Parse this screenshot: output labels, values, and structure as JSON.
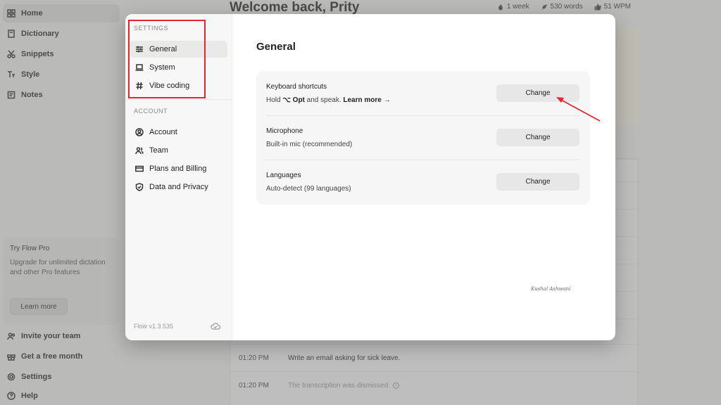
{
  "sidebar": {
    "items": [
      {
        "label": "Home",
        "icon": "grid-icon"
      },
      {
        "label": "Dictionary",
        "icon": "book-icon"
      },
      {
        "label": "Snippets",
        "icon": "scissors-icon"
      },
      {
        "label": "Style",
        "icon": "text-style-icon"
      },
      {
        "label": "Notes",
        "icon": "note-icon"
      }
    ],
    "promo": {
      "title": "Try Flow Pro",
      "description": "Upgrade for unlimited dictation and other Pro features",
      "button": "Learn more"
    },
    "bottom_items": [
      {
        "label": "Invite your team",
        "icon": "users-icon"
      },
      {
        "label": "Get a free month",
        "icon": "gift-icon"
      },
      {
        "label": "Settings",
        "icon": "gear-icon"
      },
      {
        "label": "Help",
        "icon": "help-icon"
      }
    ]
  },
  "header": {
    "welcome": "Welcome back, Prity",
    "stats": {
      "streak": "1 week",
      "words": "530 words",
      "wpm": "51 WPM"
    }
  },
  "history": {
    "rows": [
      {
        "time": "01:20 PM",
        "text": "Write an email asking for sick leave.",
        "muted": false
      },
      {
        "time": "01:20 PM",
        "text": "The transcription was dismissed.",
        "muted": true
      }
    ]
  },
  "modal": {
    "sections": {
      "settings": "SETTINGS",
      "account": "ACCOUNT"
    },
    "settings_items": [
      {
        "label": "General",
        "icon": "sliders-icon"
      },
      {
        "label": "System",
        "icon": "laptop-icon"
      },
      {
        "label": "Vibe coding",
        "icon": "hash-icon"
      }
    ],
    "account_items": [
      {
        "label": "Account",
        "icon": "user-circle-icon"
      },
      {
        "label": "Team",
        "icon": "team-icon"
      },
      {
        "label": "Plans and Billing",
        "icon": "credit-card-icon"
      },
      {
        "label": "Data and Privacy",
        "icon": "shield-icon"
      }
    ],
    "version": "Flow v1.3.535",
    "title": "General",
    "rows": [
      {
        "label": "Keyboard shortcuts",
        "sub_prefix": "Hold ",
        "sub_key": "⌥ Opt",
        "sub_suffix": " and speak. ",
        "sub_link": "Learn more →",
        "button": "Change"
      },
      {
        "label": "Microphone",
        "sub": "Built-in mic (recommended)",
        "button": "Change"
      },
      {
        "label": "Languages",
        "sub": "Auto-detect (99 languages)",
        "button": "Change"
      }
    ],
    "signature": "Kushal Ashwani"
  },
  "colors": {
    "highlight_box": "#e0282e",
    "arrow": "#e0282e"
  }
}
